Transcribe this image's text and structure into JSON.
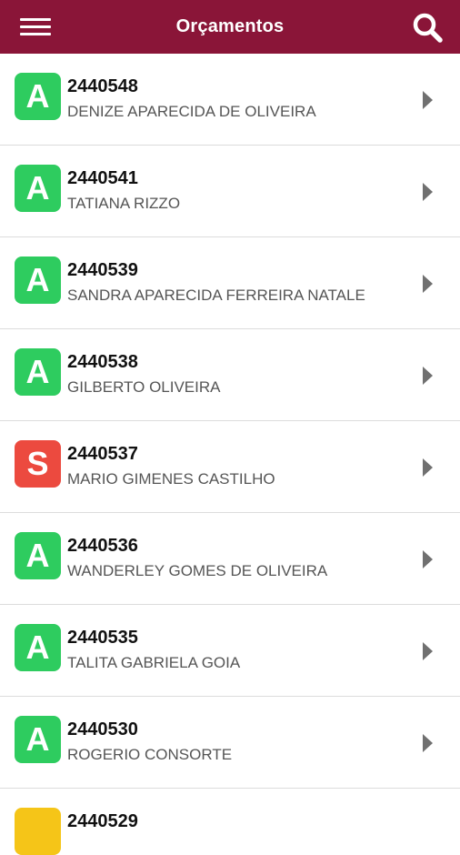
{
  "header": {
    "title": "Orçamentos",
    "menu_icon": "hamburger-menu-icon",
    "search_icon": "search-icon",
    "bar_color": "#8a1538"
  },
  "status_colors": {
    "A": "#2ecc5f",
    "S": "#ec4a3f",
    "pending": "#f5c518"
  },
  "items": [
    {
      "status": "A",
      "number": "2440548",
      "name": "DENIZE APARECIDA DE OLIVEIRA"
    },
    {
      "status": "A",
      "number": "2440541",
      "name": "TATIANA RIZZO"
    },
    {
      "status": "A",
      "number": "2440539",
      "name": "SANDRA APARECIDA FERREIRA NATALE"
    },
    {
      "status": "A",
      "number": "2440538",
      "name": "GILBERTO OLIVEIRA"
    },
    {
      "status": "S",
      "number": "2440537",
      "name": "MARIO GIMENES CASTILHO"
    },
    {
      "status": "A",
      "number": "2440536",
      "name": "WANDERLEY GOMES DE OLIVEIRA"
    },
    {
      "status": "A",
      "number": "2440535",
      "name": "TALITA GABRIELA GOIA"
    },
    {
      "status": "A",
      "number": "2440530",
      "name": "ROGERIO CONSORTE"
    }
  ],
  "partial_item": {
    "number": "2440529"
  }
}
